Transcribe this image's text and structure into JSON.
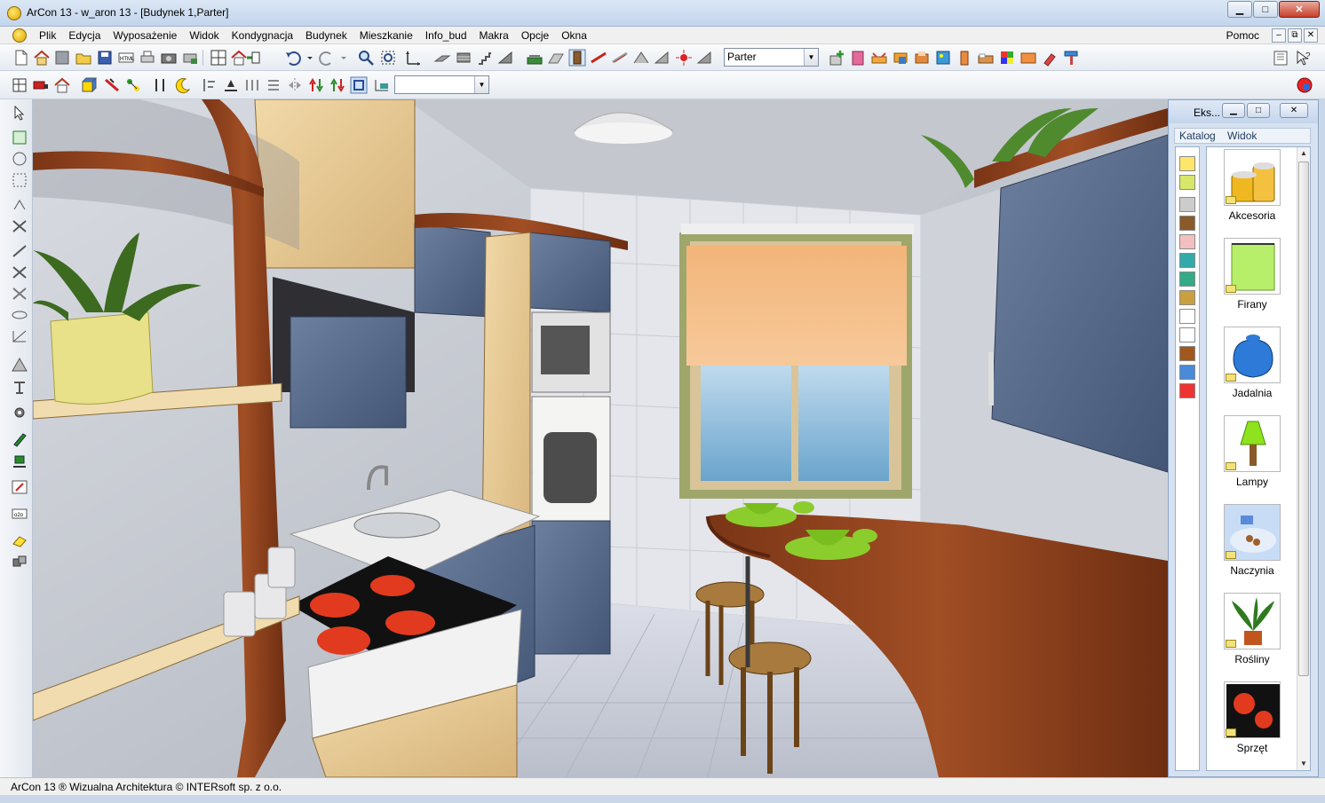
{
  "window": {
    "title": "ArCon 13 - w_aron 13 - [Budynek 1,Parter]",
    "minimize": "▁",
    "maximize": "□",
    "close": "✕"
  },
  "menu": {
    "items": [
      "Plik",
      "Edycja",
      "Wyposażenie",
      "Widok",
      "Kondygnacja",
      "Budynek",
      "Mieszkanie",
      "Info_bud",
      "Makra",
      "Opcje",
      "Okna"
    ],
    "help": "Pomoc",
    "mdi_min": "–",
    "mdi_restore": "⧉",
    "mdi_close": "✕"
  },
  "toolbar": {
    "floor_select": "Parter",
    "view_select": ""
  },
  "catalog": {
    "title": "Eks...",
    "menu": [
      "Katalog",
      "Widok"
    ],
    "items": [
      {
        "label": "Akcesoria",
        "icon": "accessories-icon"
      },
      {
        "label": "Firany",
        "icon": "curtain-icon"
      },
      {
        "label": "Jadalnia",
        "icon": "dining-icon"
      },
      {
        "label": "Lampy",
        "icon": "lamp-icon"
      },
      {
        "label": "Naczynia",
        "icon": "dishes-icon"
      },
      {
        "label": "Rośliny",
        "icon": "plant-icon"
      },
      {
        "label": "Sprzęt",
        "icon": "appliance-icon"
      }
    ]
  },
  "status": {
    "text": "ArCon 13 ® Wizualna Architektura © INTERsoft sp. z o.o."
  },
  "colors": {
    "titlebar": "#c2d5ec",
    "wood": "#8a3f1f",
    "cabinet": "#56698a"
  }
}
